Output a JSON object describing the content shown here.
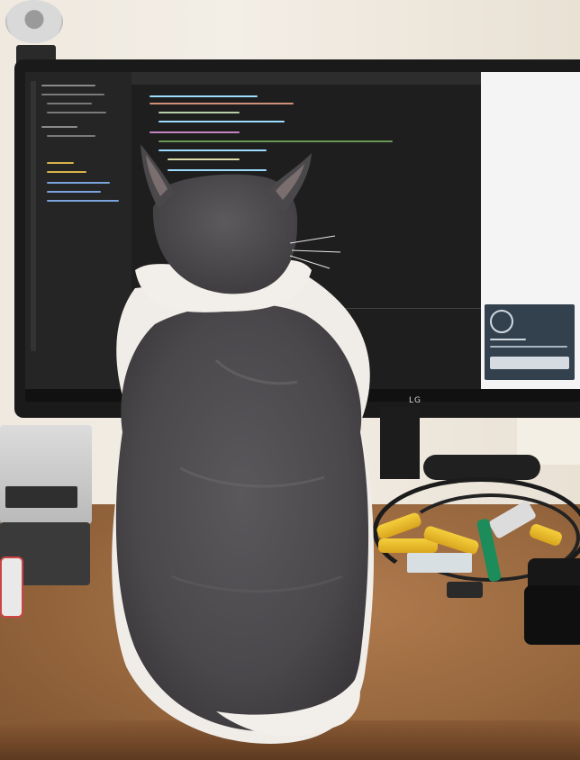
{
  "photo": {
    "monitor_brand": "LG",
    "colors": {
      "cat_grey": "#4e4c4f",
      "cat_white": "#f2efea",
      "desk": "#9b6a40",
      "wall": "#efe9df",
      "screen_dark": "#1e1e1e",
      "battery_yellow": "#f2c63a"
    }
  }
}
